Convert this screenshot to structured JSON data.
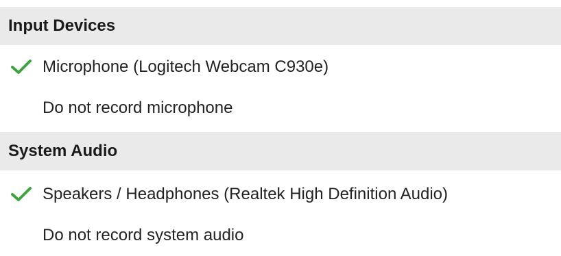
{
  "sections": [
    {
      "header": "Input Devices",
      "items": [
        {
          "label": "Microphone (Logitech Webcam C930e)",
          "checked": true,
          "icon": "checkmark-icon"
        },
        {
          "label": "Do not record microphone",
          "checked": false
        }
      ]
    },
    {
      "header": "System Audio",
      "items": [
        {
          "label": "Speakers / Headphones (Realtek High Definition Audio)",
          "checked": true,
          "icon": "checkmark-icon"
        },
        {
          "label": "Do not record system audio",
          "checked": false
        }
      ]
    }
  ],
  "colors": {
    "header_background": "#eaeaea",
    "checkmark": "#3aa53a",
    "text": "#222222"
  }
}
